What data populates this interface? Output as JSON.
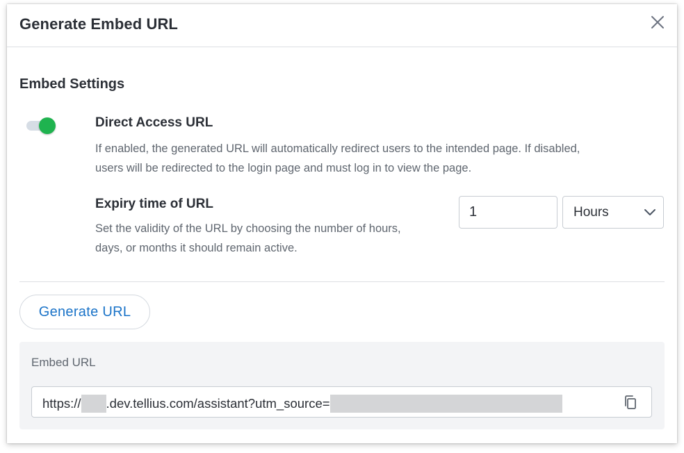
{
  "modal": {
    "title": "Generate Embed URL"
  },
  "settings": {
    "section_title": "Embed Settings",
    "direct_access": {
      "enabled": true,
      "title": "Direct Access URL",
      "description_line1": "If enabled, the generated URL will automatically redirect users to the intended page. If disabled,",
      "description_line2": "users will be redirected to the login page and must log in to view the page."
    },
    "expiry": {
      "title": "Expiry time of URL",
      "description_line1": "Set the validity of the URL by choosing the number of hours,",
      "description_line2": "days, or months it should remain active.",
      "value": "1",
      "unit": "Hours"
    }
  },
  "actions": {
    "generate_label": "Generate URL"
  },
  "embed": {
    "label": "Embed URL",
    "url_prefix": "https://",
    "url_mid": ".dev.tellius.com/assistant?utm_source="
  },
  "colors": {
    "toggle_on": "#1fb34f",
    "link_blue": "#1a73c8"
  },
  "icons": {
    "close": "close-icon",
    "chevron": "chevron-down-icon",
    "copy": "copy-icon"
  }
}
